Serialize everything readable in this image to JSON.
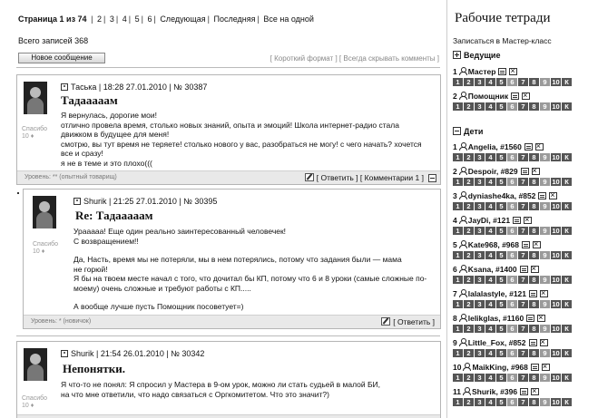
{
  "pager": {
    "current": "Страница 1 из 74",
    "pages": [
      "2",
      "3",
      "4",
      "5",
      "6"
    ],
    "next": "Следующая",
    "last": "Последняя",
    "all": "Все на одной"
  },
  "total": "Всего записей 368",
  "new_message_button": "Новое сообщение",
  "view_links": {
    "short": "[ Короткий формат ]",
    "hide": "[ Всегда скрывать комменты ]"
  },
  "posts": [
    {
      "header": "Таська | 18:28 27.01.2010 | № 30387",
      "title": "Тадааааам",
      "thanks": "Спасибо",
      "thanks_count": "10 ♦",
      "body": [
        "Я вернулась, дорогие мои!",
        "отлично провела время, столько новых знаний, опыта и эмоций! Школа интернет-радио стала",
        "движком в будущее для меня!",
        "смотрю, вы тут время не теряете! столько нового у вас, разобраться не могу! с чего начать? хочется",
        "все и сразу!",
        "я не в теме и это плохо((("
      ],
      "level": "Уровень: ** (опытный товарищ)",
      "reply": "[ Ответить ]",
      "comments": "[ Комментарии 1 ]"
    },
    {
      "header": "Shurik | 21:25 27.01.2010 | № 30395",
      "title": "Re: Тадааааам",
      "thanks": "Спасибо",
      "thanks_count": "10 ♦",
      "body": [
        "Урааааа! Еще один реально заинтересованный человечек!",
        "С возвращением!!",
        "",
        "Да, Насть, время мы не потеряли, мы в нем потерялись, потому что задания были — мама",
        "не горюй!",
        "Я бы на твоем месте начал с того, что дочитал бы КП, потому что 6 и 8 уроки (самые сложные по-",
        "моему) очень сложные и требуют работы с КП.....",
        "",
        "А вообще лучше пусть Помощник посоветует=)"
      ],
      "level": "Уровень: * (новичок)",
      "reply": "[ Ответить ]"
    },
    {
      "header": "Shurik | 21:54 26.01.2010 | № 30342",
      "title": "Непонятки.",
      "thanks": "Спасибо",
      "thanks_count": "10 ♦",
      "body": [
        "Я что-то не понял: Я спросил у Мастера в 9-ом урок, можно ли стать судьей в малой БИ,",
        "на что мне ответили, что надо связаться с Оргкомитетом. Что это значит?)"
      ]
    }
  ],
  "sidebar": {
    "title": "Рабочие тетради",
    "signup": "Записаться в Мастер-класс",
    "group_leaders": "Ведущие",
    "group_kids": "Дети",
    "leaders": [
      {
        "num": "1",
        "name": "Мастер"
      },
      {
        "num": "2",
        "name": "Помощник"
      }
    ],
    "kids": [
      {
        "num": "1",
        "name": "Angelia, #1560"
      },
      {
        "num": "2",
        "name": "Despoir, #829"
      },
      {
        "num": "3",
        "name": "dyniashe4ka, #852"
      },
      {
        "num": "4",
        "name": "JayDi, #121"
      },
      {
        "num": "5",
        "name": "Kate968, #968"
      },
      {
        "num": "6",
        "name": "Ksana, #1400"
      },
      {
        "num": "7",
        "name": "lalalastyle, #121"
      },
      {
        "num": "8",
        "name": "lelikglas, #1160"
      },
      {
        "num": "9",
        "name": "Little_Fox, #852"
      },
      {
        "num": "10",
        "name": "MaikKing, #968"
      },
      {
        "num": "11",
        "name": "Shurik, #396"
      }
    ],
    "tiles": [
      "1",
      "2",
      "3",
      "4",
      "5",
      "6",
      "7",
      "8",
      "9",
      "10",
      "К"
    ]
  }
}
